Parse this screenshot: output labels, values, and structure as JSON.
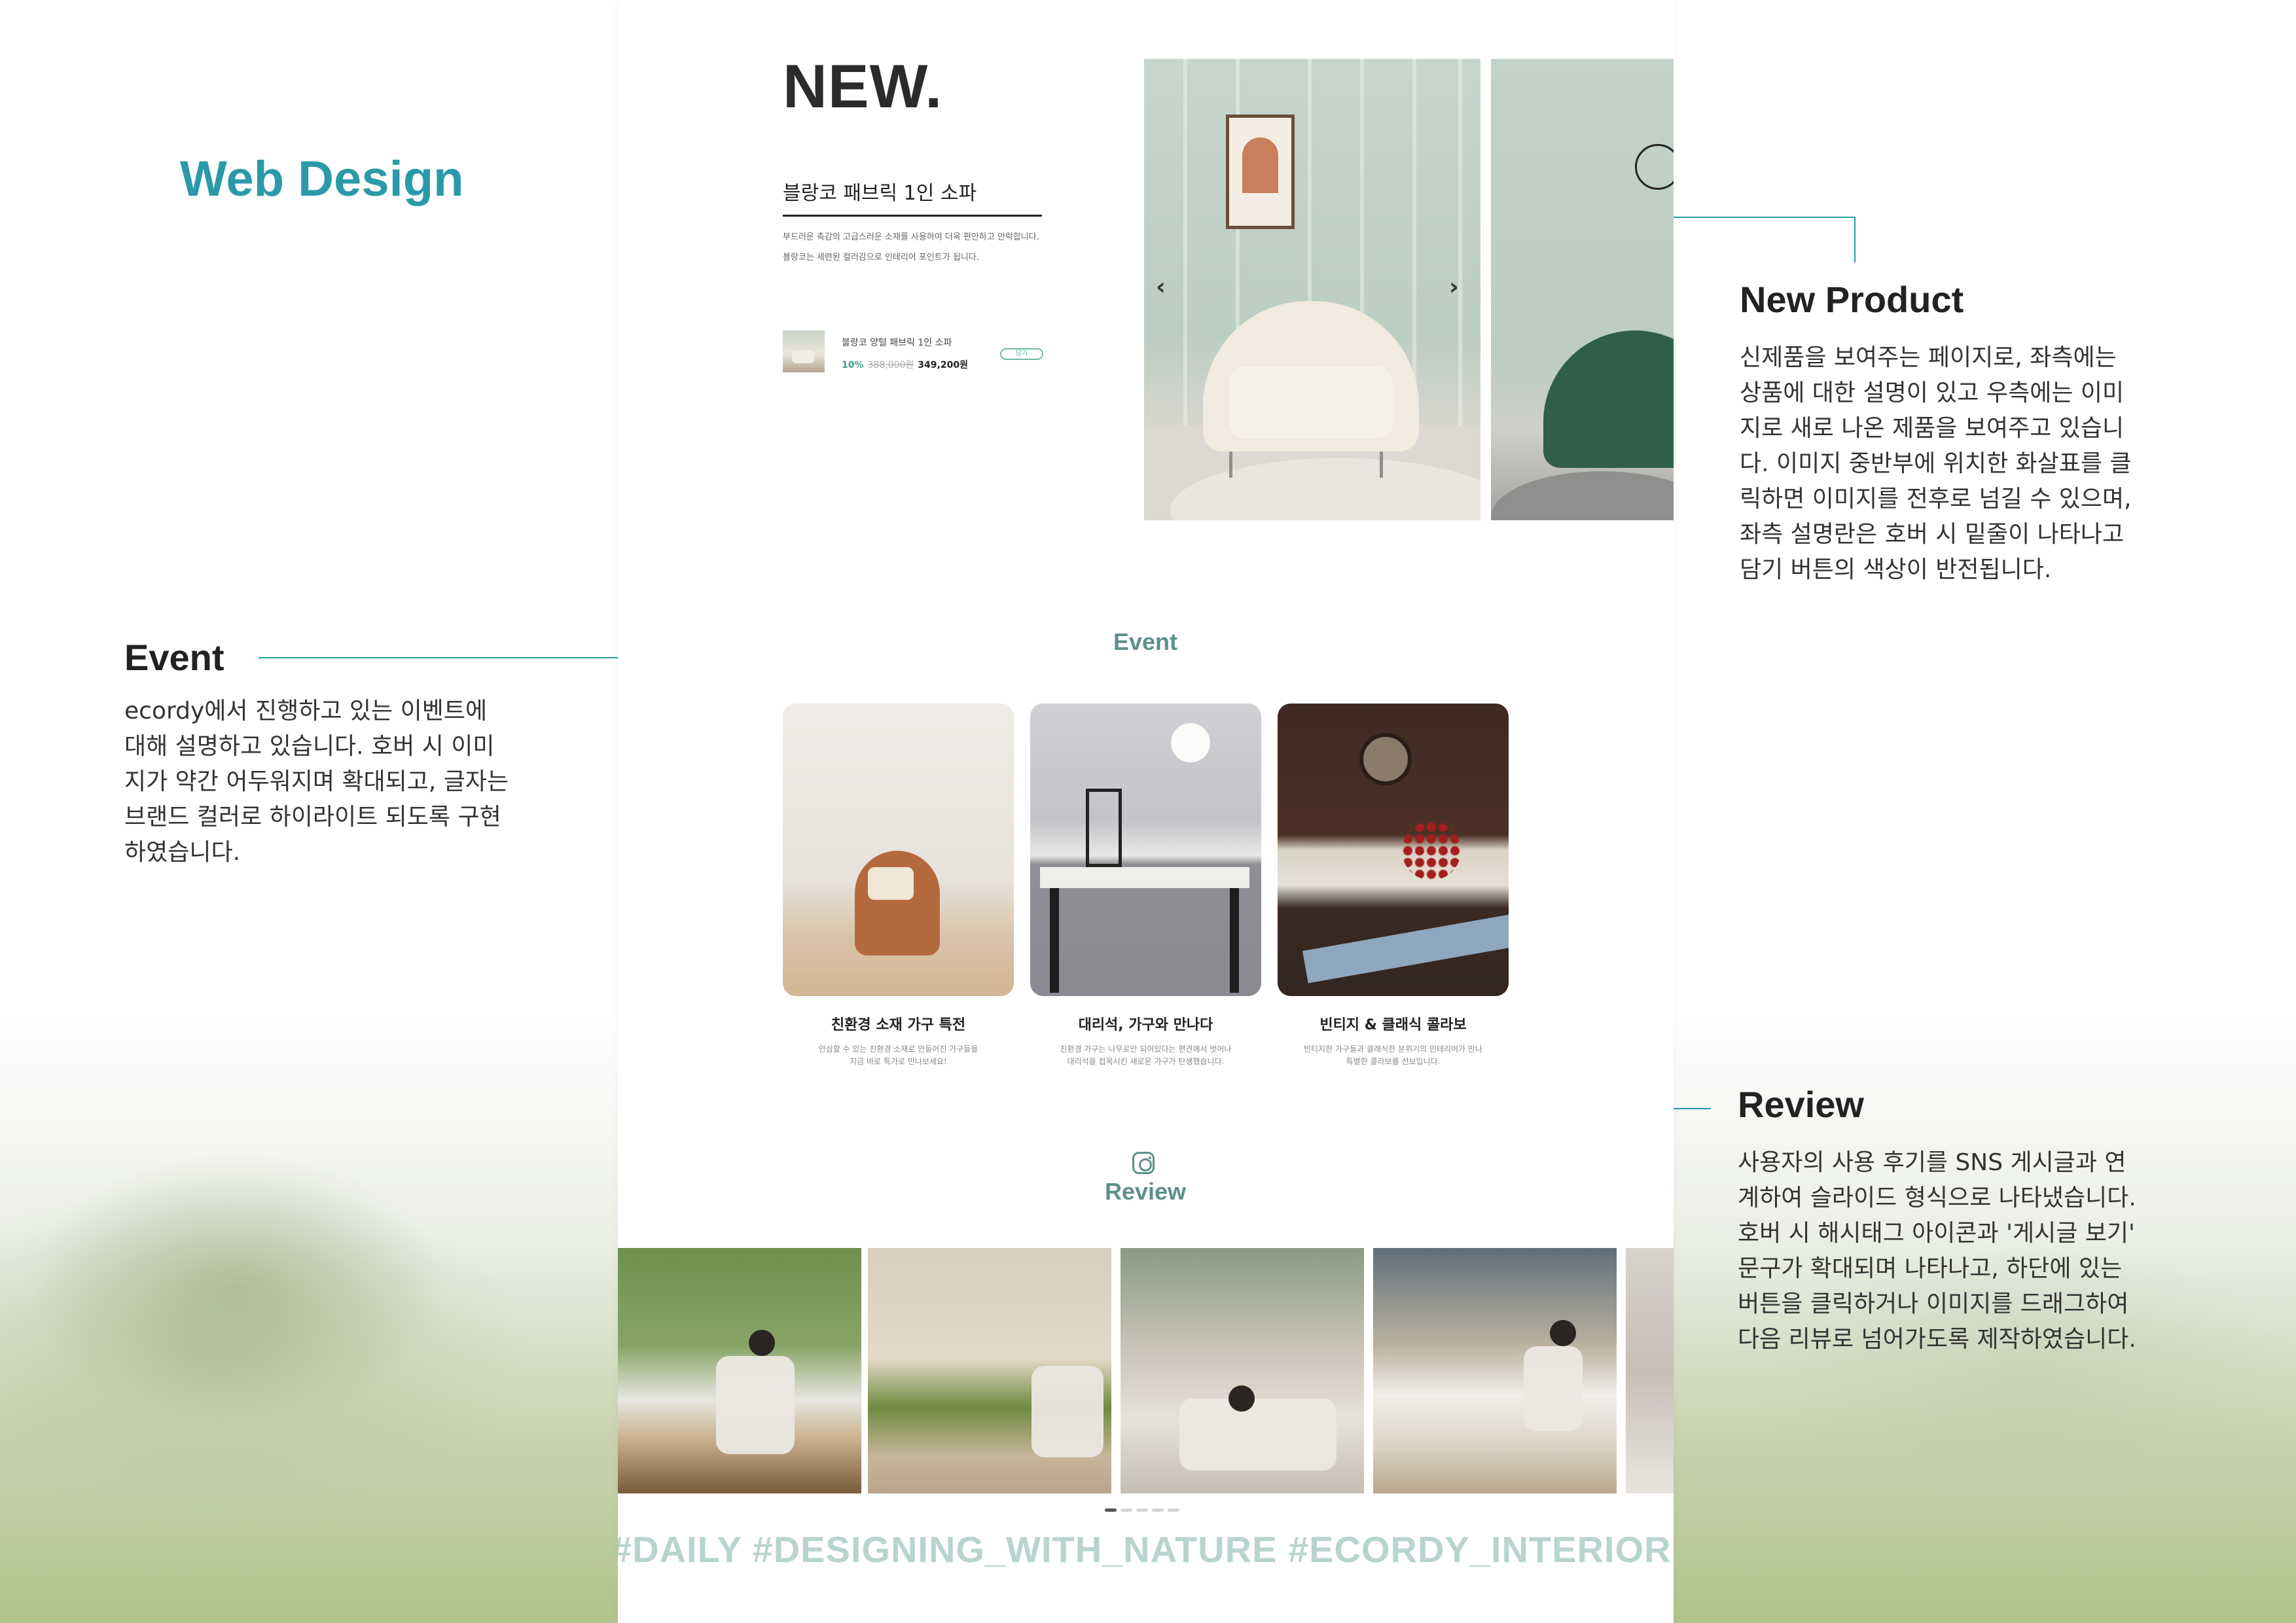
{
  "annotations": {
    "title": "Web Design",
    "new_product": {
      "title": "New Product",
      "desc": "신제품을 보여주는 페이지로, 좌측에는\n상품에 대한 설명이 있고 우측에는 이미\n지로 새로 나온 제품을 보여주고 있습니\n다. 이미지 중반부에 위치한 화살표를 클\n릭하면 이미지를 전후로 넘길 수 있으며,\n좌측 설명란은 호버 시 밑줄이 나타나고\n담기 버튼의 색상이 반전됩니다."
    },
    "event": {
      "title": "Event",
      "desc": "ecordy에서 진행하고 있는 이벤트에\n대해 설명하고 있습니다. 호버 시 이미\n지가 약간 어두워지며 확대되고, 글자는\n브랜드 컬러로 하이라이트 되도록 구현\n하였습니다."
    },
    "review": {
      "title": "Review",
      "desc": "사용자의 사용 후기를 SNS 게시글과 연\n계하여 슬라이드 형식으로 나타냈습니다.\n호버 시 해시태그 아이콘과 '게시글 보기'\n문구가 확대되며 나타나고, 하단에 있는\n버튼을 클릭하거나 이미지를 드래그하여\n다음 리뷰로 넘어가도록 제작하였습니다."
    }
  },
  "new_section": {
    "heading": "NEW.",
    "product_name": "블랑코 패브릭 1인 소파",
    "product_desc": "부드러운 촉감의 고급스러운 소재를 사용하여 더욱 편안하고 안락합니다.\n블랑코는 세련된 컬러감으로 인테리어 포인트가 됩니다.",
    "mini_item": {
      "name": "블랑코 양털 패브릭 1인 소파",
      "discount": "10%",
      "old_price": "388,000원",
      "price": "349,200원",
      "cart_label": "담기"
    },
    "prev_arrow": "‹",
    "next_arrow": "›"
  },
  "event_section": {
    "title": "Event",
    "cards": [
      {
        "name": "친환경 소재 가구 특전",
        "desc": "안심할 수 있는 친환경 소재로 만들어진 가구들을\n지금 바로 특가로 만나보세요!"
      },
      {
        "name": "대리석, 가구와 만나다",
        "desc": "친환경 가구는 나무로만 되어있다는 편견에서 벗어나\n대리석을 접목시킨 새로운 가구가 탄생했습니다."
      },
      {
        "name": "빈티지 & 클래식 콜라보",
        "desc": "빈티지한 가구들과 클래식한 분위기의 인테리어가 만나\n특별한 콜라보를 선보입니다."
      }
    ]
  },
  "review_section": {
    "title": "Review",
    "hashtags": "#DAILY #DESIGNING_WITH_NATURE #ECORDY_INTERIOR #SUSTAINABLE",
    "pager_count": 5,
    "pager_active": 0
  },
  "colors": {
    "brand": "#2a9aa8",
    "section_title": "#5e8f8b",
    "hashtag": "#b8d4cf"
  }
}
